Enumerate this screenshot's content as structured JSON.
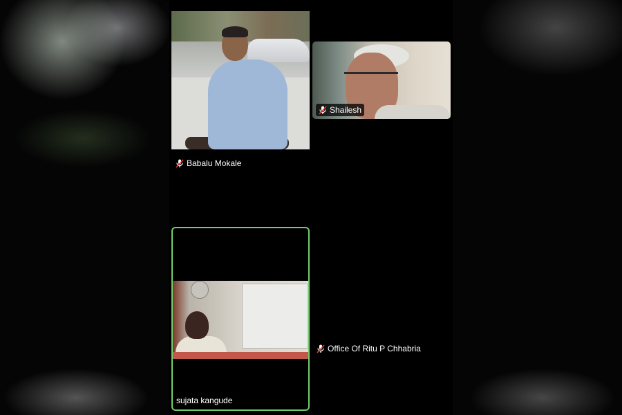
{
  "participants": [
    {
      "name": "Babalu Mokale",
      "muted": true
    },
    {
      "name": "Shailesh",
      "muted": true
    },
    {
      "name": "sujata kangude",
      "muted": false,
      "active_speaker": true
    },
    {
      "name": "Office Of Ritu P Chhabria",
      "muted": true
    }
  ],
  "colors": {
    "active_border": "#6fcf6a",
    "background": "#000000"
  },
  "icons": {
    "muted": "mic-off-icon"
  }
}
